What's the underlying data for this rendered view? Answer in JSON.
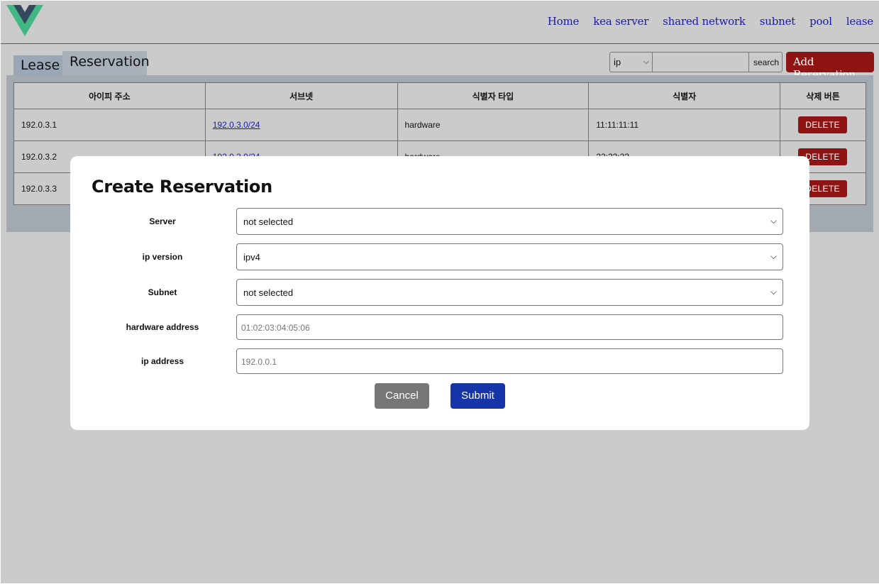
{
  "header": {
    "logo_icon": "vue-logo-icon",
    "nav": [
      "Home",
      "kea server",
      "shared network",
      "subnet",
      "pool",
      "lease"
    ]
  },
  "tabs": {
    "lease": "Lease",
    "reservation": "Reservation"
  },
  "search": {
    "field_value": "ip",
    "query": "",
    "button_label": "search"
  },
  "add_button_label": "Add Reservation",
  "table": {
    "columns": [
      "아이피 주소",
      "서브넷",
      "식별자 타입",
      "식별자",
      "삭제 버튼"
    ],
    "rows": [
      {
        "ip": "192.0.3.1",
        "subnet": "192.0.3.0/24",
        "type": "hardware",
        "identifier": "11:11:11:11",
        "delete": "DELETE"
      },
      {
        "ip": "192.0.3.2",
        "subnet": "192.0.3.0/24",
        "type": "hardware",
        "identifier": "22:22:22",
        "delete": "DELETE"
      },
      {
        "ip": "192.0.3.3",
        "subnet": "",
        "type": "",
        "identifier": "",
        "delete": "DELETE"
      }
    ]
  },
  "modal": {
    "title": "Create Reservation",
    "fields": {
      "server": {
        "label": "Server",
        "value": "not selected"
      },
      "ip_version": {
        "label": "ip version",
        "value": "ipv4"
      },
      "subnet": {
        "label": "Subnet",
        "value": "not selected"
      },
      "hardware_address": {
        "label": "hardware address",
        "placeholder": "01:02:03:04:05:06"
      },
      "ip_address": {
        "label": "ip address",
        "placeholder": "192.0.0.1"
      }
    },
    "cancel_label": "Cancel",
    "submit_label": "Submit"
  },
  "colors": {
    "background": "#cbcbcb",
    "danger": "#8f1414",
    "primary": "#1535a8",
    "link": "#1a1aa6"
  }
}
